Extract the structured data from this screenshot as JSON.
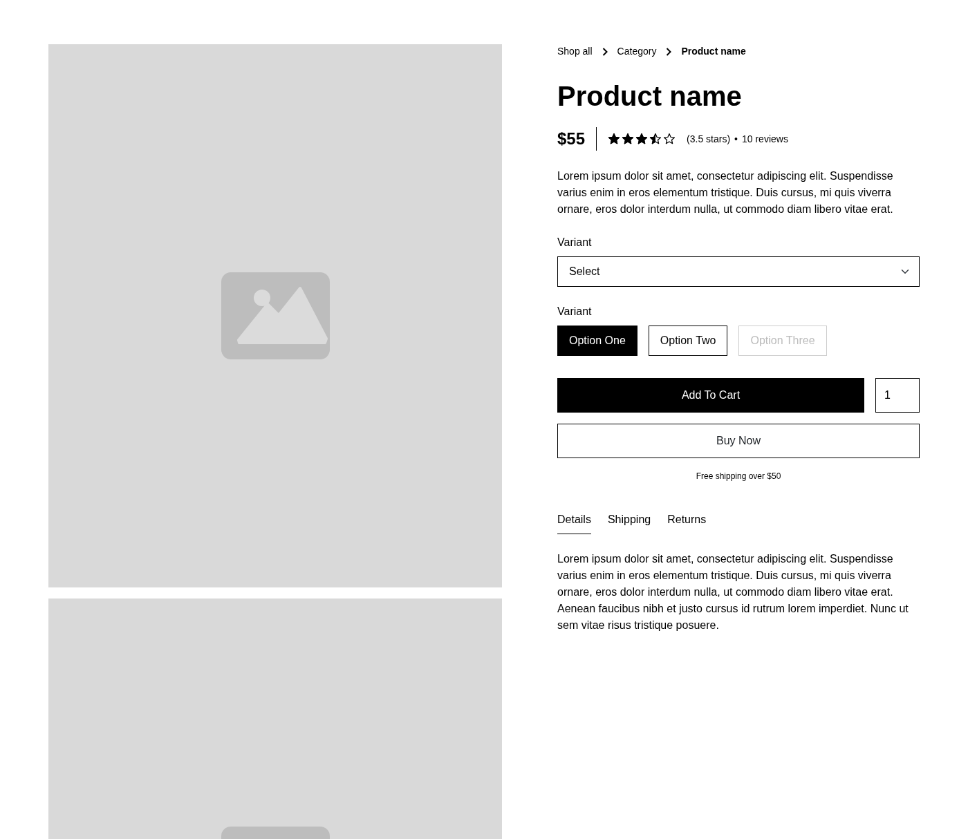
{
  "breadcrumb": [
    {
      "label": "Shop all",
      "current": false
    },
    {
      "label": "Category",
      "current": false
    },
    {
      "label": "Product name",
      "current": true
    }
  ],
  "title": "Product name",
  "price": "$55",
  "rating": {
    "stars": 3.5,
    "label": "(3.5 stars)",
    "separator": "•",
    "reviews": "10 reviews"
  },
  "description": "Lorem ipsum dolor sit amet, consectetur adipiscing elit. Suspendisse varius enim in eros elementum tristique. Duis cursus, mi quis viverra ornare, eros dolor interdum nulla, ut commodo diam libero vitae erat.",
  "variant_select": {
    "label": "Variant",
    "value": "Select"
  },
  "variant_options": {
    "label": "Variant",
    "options": [
      {
        "label": "Option One",
        "selected": true,
        "disabled": false
      },
      {
        "label": "Option Two",
        "selected": false,
        "disabled": false
      },
      {
        "label": "Option Three",
        "selected": false,
        "disabled": true
      }
    ]
  },
  "add_to_cart": "Add To Cart",
  "quantity": "1",
  "buy_now": "Buy Now",
  "shipping_note": "Free shipping over $50",
  "tabs": [
    {
      "label": "Details",
      "selected": true
    },
    {
      "label": "Shipping",
      "selected": false
    },
    {
      "label": "Returns",
      "selected": false
    }
  ],
  "tab_content": "Lorem ipsum dolor sit amet, consectetur adipiscing elit. Suspendisse varius enim in eros elementum tristique. Duis cursus, mi quis viverra ornare, eros dolor interdum nulla, ut commodo diam libero vitae erat. Aenean faucibus nibh et justo cursus id rutrum lorem imperdiet. Nunc ut sem vitae risus tristique posuere."
}
